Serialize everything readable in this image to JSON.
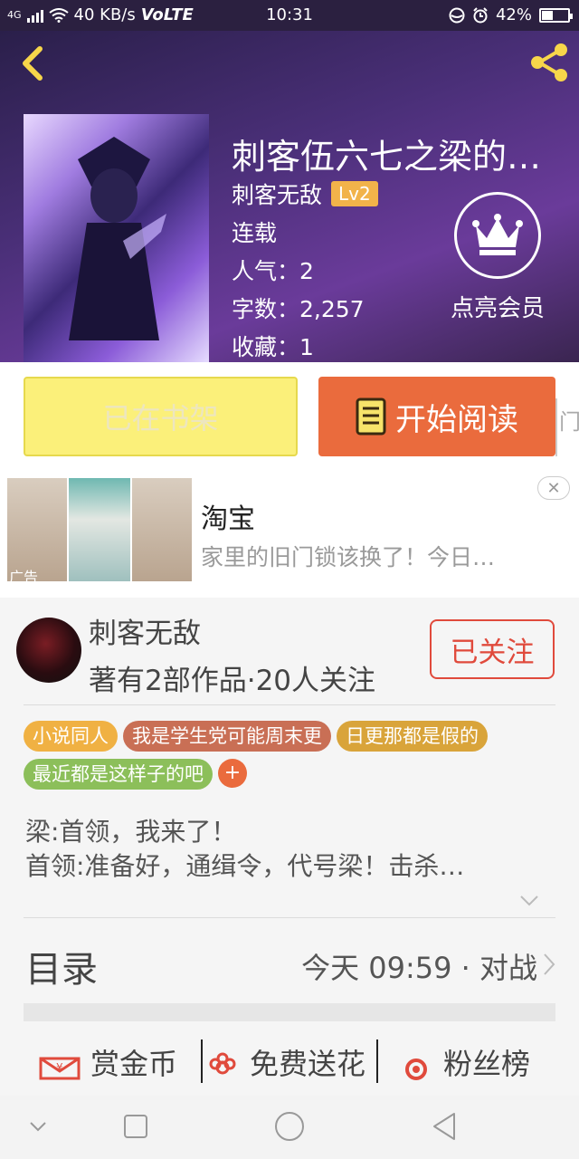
{
  "status_bar": {
    "network": "4G",
    "speed": "40 KB/s",
    "volte": "VoLTE",
    "time": "10:31",
    "battery": "42%",
    "battery_level": 0.42
  },
  "header": {
    "back_icon": "chevron-left-icon",
    "share_icon": "share-icon",
    "title": "刺客伍六七之梁的…",
    "author": "刺客无敌",
    "level": "Lv2",
    "status": "连载",
    "popularity": "人气：2",
    "word_count": "字数：2,257",
    "favorites": "收藏：1",
    "vip_label": "点亮会员",
    "vip_icon": "crown-icon"
  },
  "actions": {
    "shelf_label": "已在书架",
    "read_label": "开始阅读",
    "read_icon": "book-icon",
    "edge_text": "门"
  },
  "ad": {
    "tag": "广告",
    "title": "淘宝",
    "description": "家里的旧门锁该换了！今日…",
    "close_icon": "close-icon"
  },
  "author_section": {
    "name": "刺客无敌",
    "stats": "著有2部作品·20人关注",
    "follow_label": "已关注"
  },
  "tags": [
    {
      "label": "小说同人",
      "color": "#f0b143"
    },
    {
      "label": "我是学生党可能周末更",
      "color": "#c96f55"
    },
    {
      "label": "日更那都是假的",
      "color": "#d9a43a"
    },
    {
      "label": "最近都是这样子的吧",
      "color": "#8cbf5a"
    }
  ],
  "tag_add": "+",
  "synopsis": {
    "line1": "梁:首领，我来了！",
    "line2": "首领:准备好，通缉令，代号梁！击杀…"
  },
  "catalog": {
    "label": "目录",
    "update": "今天 09:59 · 对战"
  },
  "functions": [
    {
      "label": "赏金币",
      "icon": "reward-envelope-icon"
    },
    {
      "label": "免费送花",
      "icon": "flower-icon"
    },
    {
      "label": "粉丝榜",
      "icon": "ranking-icon"
    }
  ],
  "colors": {
    "accent_orange": "#ea6b3d",
    "shelf_yellow": "#fbf07a",
    "follow_red": "#e04a3c",
    "level_badge": "#f2b34a"
  }
}
